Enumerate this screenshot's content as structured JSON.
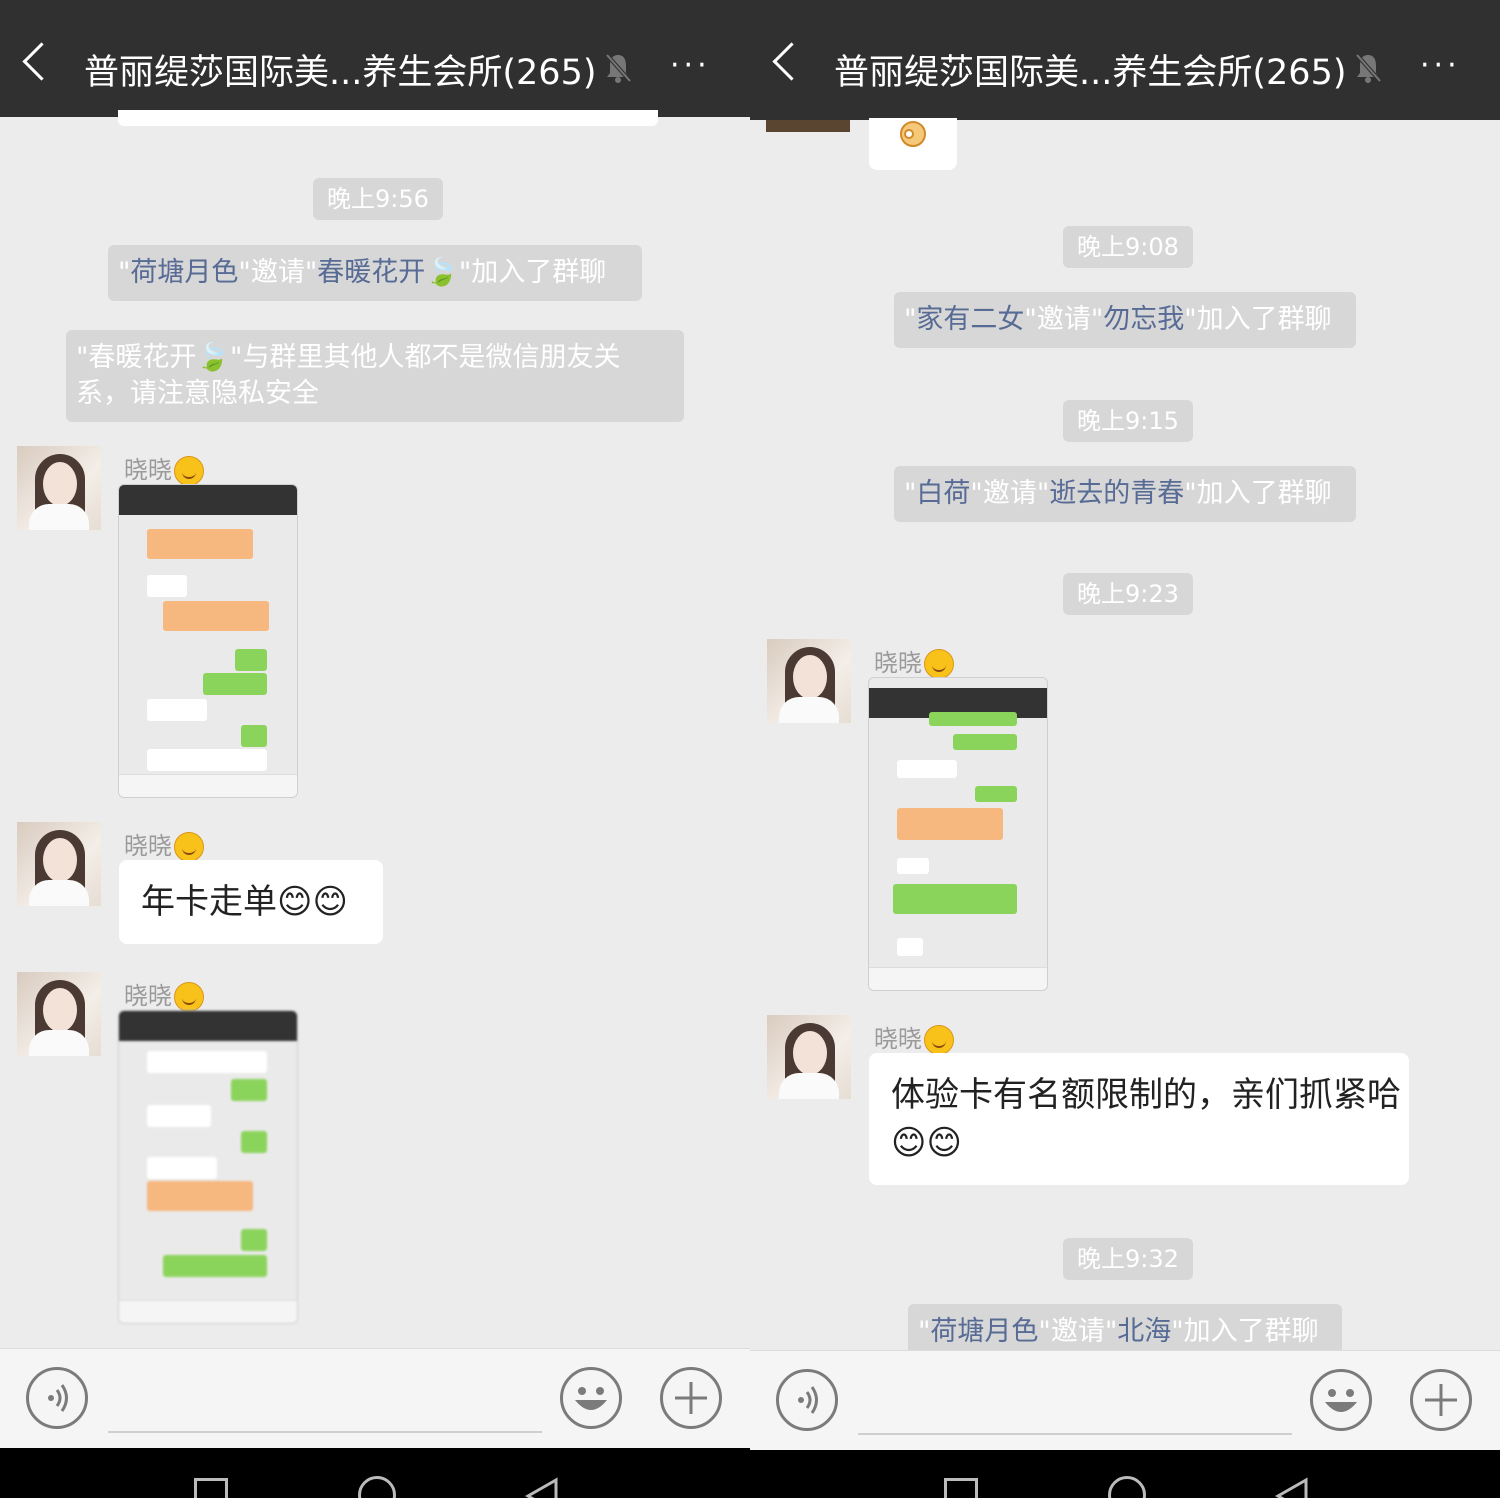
{
  "title": "普丽缇莎国际美...养生会所(265)",
  "more_label": "···",
  "left": {
    "timestamp": "晚上9:56",
    "sys1": {
      "q1": "\"",
      "n1": "荷塘月色",
      "mid": "\"邀请\"",
      "n2": "春暖花开",
      "end": "\"加入了群聊"
    },
    "sys2_line1": "\"春暖花开🍃\"与群里其他人都不是微信朋友关",
    "sys2_line2": "系，请注意隐私安全",
    "sender": "晓晓",
    "text_message": "年卡走单😊😊"
  },
  "right": {
    "timestamps": [
      "晚上9:08",
      "晚上9:15",
      "晚上9:23",
      "晚上9:32"
    ],
    "sys1": {
      "q": "\"",
      "n1": "家有二女",
      "mid": "\"邀请\"",
      "n2": "勿忘我",
      "end": "\"加入了群聊"
    },
    "sys2": {
      "q": "\"",
      "n1": "白荷",
      "mid": "\"邀请\"",
      "n2": "逝去的青春",
      "end": "\"加入了群聊"
    },
    "sys3": {
      "q": "\"",
      "n1": "荷塘月色",
      "mid": "\"邀请\"",
      "n2": "北海",
      "end": "\"加入了群聊"
    },
    "sender": "晓晓",
    "text_line1": "体验卡有名额限制的，亲们抓紧哈",
    "text_line2": "😊😊"
  },
  "colors": {
    "titlebar": "#303030",
    "chat_bg": "#ececec",
    "name_link": "#576b95"
  },
  "icons": [
    "back-icon",
    "mute-bell-icon",
    "more-icon",
    "voice-icon",
    "emoji-icon",
    "plus-icon",
    "nav-square-icon",
    "nav-home-icon",
    "nav-back-icon"
  ]
}
